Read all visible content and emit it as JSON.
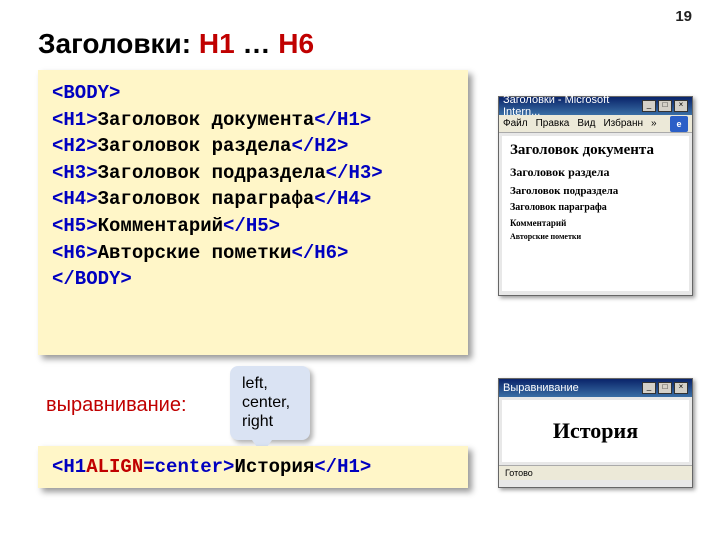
{
  "page_number": "19",
  "title": {
    "prefix": "Заголовки: ",
    "h1": "H1",
    "mid": " … ",
    "h6": "H6"
  },
  "main_code": {
    "body_open": "<BODY>",
    "lines": [
      {
        "open": "<H1>",
        "text": "Заголовок документа",
        "close": "</H1>"
      },
      {
        "open": "<H2>",
        "text": "Заголовок раздела",
        "close": "</H2>"
      },
      {
        "open": "<H3>",
        "text": "Заголовок подраздела",
        "close": "</H3>"
      },
      {
        "open": "<H4>",
        "text": "Заголовок параграфа",
        "close": "</H4>"
      },
      {
        "open": "<H5>",
        "text": "Комментарий",
        "close": "</H5>"
      },
      {
        "open": "<H6>",
        "text": "Авторские пометки",
        "close": "</H6>"
      }
    ],
    "body_close": "</BODY>"
  },
  "align_label": "выравнивание:",
  "callout": "left, center, right",
  "align_code": {
    "open_lt": "<H1 ",
    "attr": "ALIGN",
    "eq_rest": "=center>",
    "text": "История",
    "close": "</H1>"
  },
  "browser1": {
    "title": "Заголовки - Microsoft Intern...",
    "menu": [
      "Файл",
      "Правка",
      "Вид",
      "Избранн",
      "»"
    ],
    "h1": "Заголовок документа",
    "h2": "Заголовок раздела",
    "h3": "Заголовок подраздела",
    "h4": "Заголовок параграфа",
    "h5": "Комментарий",
    "h6": "Авторские пометки"
  },
  "browser2": {
    "title": "Выравнивание",
    "heading": "История",
    "status": "Готово"
  }
}
